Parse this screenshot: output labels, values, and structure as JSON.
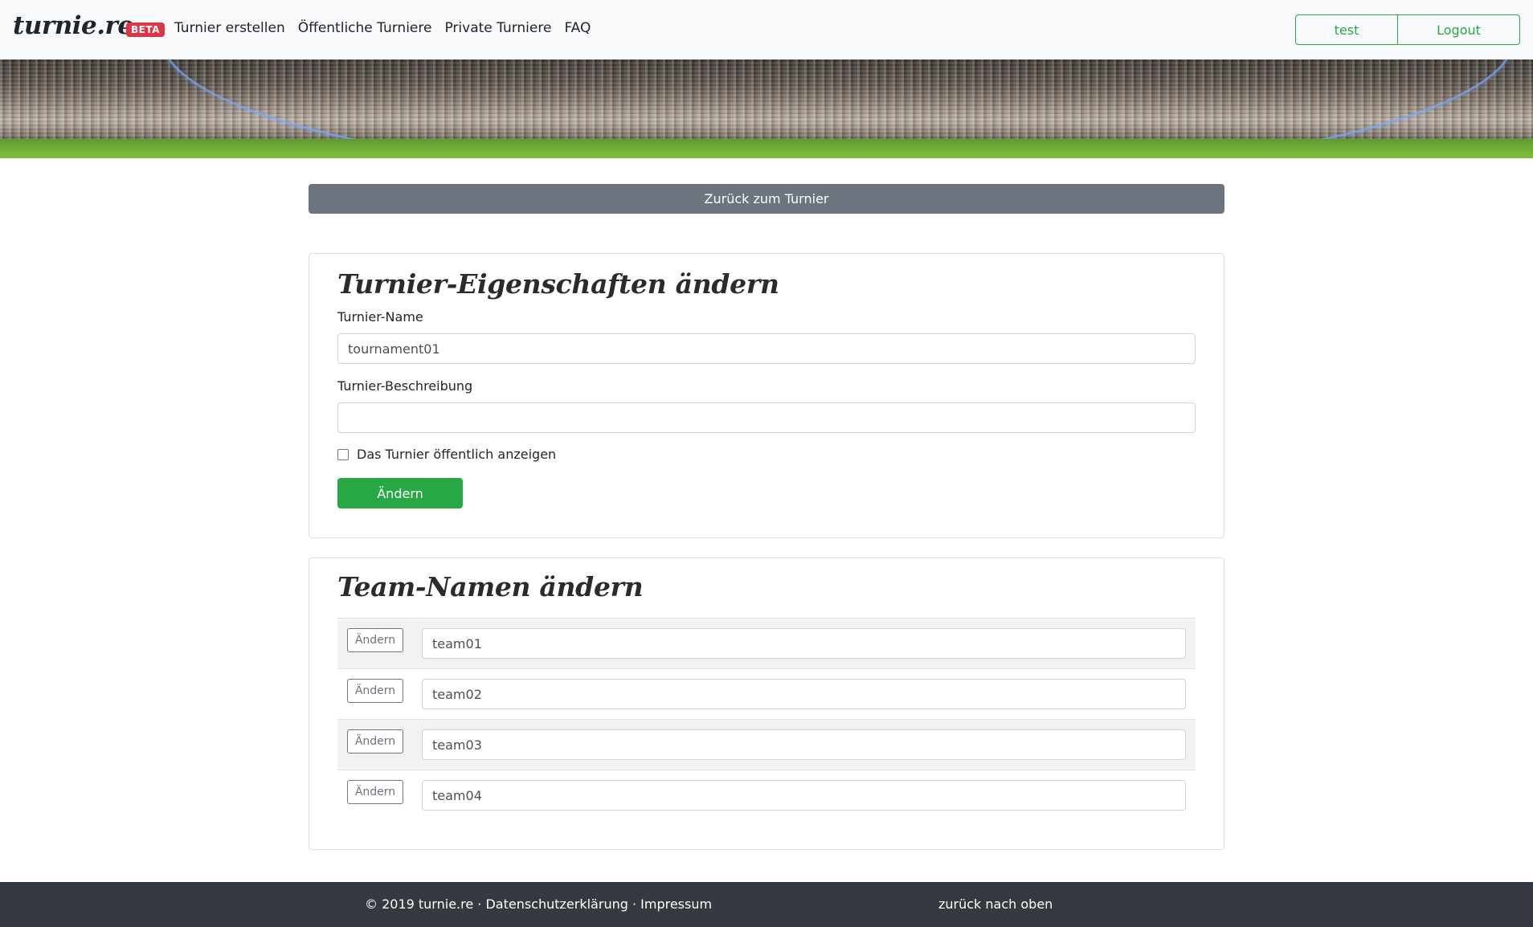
{
  "navbar": {
    "brand": "turnie.re",
    "badge": "BETA",
    "links": [
      "Turnier erstellen",
      "Öffentliche Turniere",
      "Private Turniere",
      "FAQ"
    ],
    "user_button": "test",
    "logout_button": "Logout"
  },
  "back_button": "Zurück zum Turnier",
  "properties_card": {
    "title": "Turnier-Eigenschaften ändern",
    "name_label": "Turnier-Name",
    "name_value": "tournament01",
    "description_label": "Turnier-Beschreibung",
    "description_value": "",
    "public_checkbox_label": "Das Turnier öffentlich anzeigen",
    "public_checked": false,
    "submit_label": "Ändern"
  },
  "teams_card": {
    "title": "Team-Namen ändern",
    "rows": [
      {
        "button": "Ändern",
        "name": "team01"
      },
      {
        "button": "Ändern",
        "name": "team02"
      },
      {
        "button": "Ändern",
        "name": "team03"
      },
      {
        "button": "Ändern",
        "name": "team04"
      }
    ]
  },
  "footer": {
    "copyright": "© 2019 turnie.re",
    "separator": " · ",
    "privacy": "Datenschutzerklärung",
    "imprint": "Impressum",
    "back_to_top": "zurück nach oben"
  },
  "colors": {
    "success": "#28a745",
    "secondary": "#6c757d",
    "danger": "#dc3545",
    "footer_bg": "#343a40",
    "navbar_bg": "#f8f9fa"
  }
}
